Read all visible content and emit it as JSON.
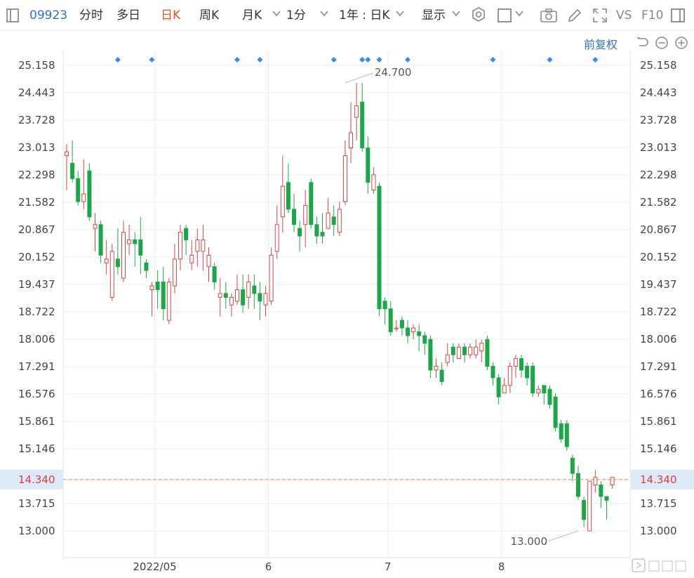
{
  "toolbar": {
    "code": "09923",
    "tabs": [
      "分时",
      "多日",
      "日K",
      "周K",
      "月K",
      "1分"
    ],
    "active_tab": "日K",
    "range": "1年 : 日K",
    "display": "显示",
    "vs": "VS",
    "f10": "F10"
  },
  "adjust_label": "前复权",
  "colors": {
    "up": "#d64545",
    "down": "#1aa846",
    "grid": "#eeeeee",
    "current": "#f07c3e",
    "accent": "#2f75c8",
    "marker": "#2f8ef0"
  },
  "chart_data": {
    "type": "candlestick",
    "ylim": [
      12.75,
      25.4
    ],
    "y_ticks": [
      "25.158",
      "24.443",
      "23.728",
      "23.013",
      "22.298",
      "21.582",
      "20.867",
      "20.152",
      "19.437",
      "18.722",
      "18.006",
      "17.291",
      "16.576",
      "15.861",
      "15.146",
      "13.715",
      "13.000"
    ],
    "current_price": "14.340",
    "x_labels": [
      "2022/05",
      "6",
      "7",
      "8"
    ],
    "x_label_index": [
      15.5,
      35.5,
      56.5,
      76.5
    ],
    "max_label": "24.700",
    "min_label": "13.000",
    "max_index": 49,
    "min_index": 90,
    "event_markers": [
      9,
      15,
      30,
      34,
      47,
      52,
      53,
      55,
      60,
      75,
      85,
      93
    ],
    "candles": [
      [
        22.8,
        22.9,
        21.9,
        23.1
      ],
      [
        22.6,
        22.2,
        22.1,
        23.2
      ],
      [
        22.2,
        21.6,
        21.5,
        22.4
      ],
      [
        21.6,
        21.8,
        21.4,
        22.7
      ],
      [
        22.4,
        21.2,
        21.1,
        22.6
      ],
      [
        20.9,
        21.0,
        20.3,
        21.3
      ],
      [
        21.0,
        20.2,
        20.0,
        21.1
      ],
      [
        20.0,
        20.1,
        19.7,
        20.6
      ],
      [
        19.1,
        20.3,
        19.0,
        20.5
      ],
      [
        20.1,
        19.9,
        19.7,
        20.9
      ],
      [
        19.6,
        20.8,
        19.5,
        21.1
      ],
      [
        20.5,
        20.6,
        20.2,
        21.0
      ],
      [
        20.6,
        20.5,
        19.9,
        20.8
      ],
      [
        20.6,
        20.2,
        19.7,
        21.2
      ],
      [
        20.0,
        19.8,
        19.6,
        20.1
      ],
      [
        19.3,
        19.4,
        18.6,
        19.5
      ],
      [
        19.5,
        19.3,
        18.8,
        19.8
      ],
      [
        19.5,
        18.8,
        18.5,
        19.9
      ],
      [
        18.5,
        19.5,
        18.4,
        19.6
      ],
      [
        19.4,
        20.1,
        19.2,
        20.5
      ],
      [
        20.1,
        20.8,
        19.8,
        21.0
      ],
      [
        20.9,
        20.6,
        20.2,
        21.0
      ],
      [
        20.0,
        20.2,
        19.8,
        20.6
      ],
      [
        20.3,
        20.6,
        19.9,
        20.9
      ],
      [
        20.3,
        20.6,
        19.8,
        21.0
      ],
      [
        19.9,
        20.2,
        19.5,
        20.4
      ],
      [
        19.9,
        19.5,
        19.3,
        20.0
      ],
      [
        19.1,
        19.2,
        18.6,
        19.6
      ],
      [
        19.2,
        19.1,
        18.8,
        19.5
      ],
      [
        18.9,
        19.1,
        18.6,
        19.2
      ],
      [
        19.0,
        19.3,
        18.9,
        19.7
      ],
      [
        19.3,
        18.9,
        18.7,
        19.7
      ],
      [
        19.1,
        19.5,
        18.8,
        19.7
      ],
      [
        19.4,
        19.2,
        18.8,
        19.7
      ],
      [
        19.2,
        19.0,
        18.5,
        19.5
      ],
      [
        18.9,
        19.2,
        18.6,
        19.4
      ],
      [
        19.0,
        20.2,
        18.9,
        20.4
      ],
      [
        20.3,
        21.0,
        20.1,
        21.5
      ],
      [
        21.2,
        22.0,
        20.8,
        22.8
      ],
      [
        22.1,
        21.4,
        21.3,
        22.6
      ],
      [
        21.4,
        21.0,
        20.8,
        21.8
      ],
      [
        20.9,
        20.7,
        20.3,
        21.1
      ],
      [
        21.0,
        21.5,
        20.4,
        21.9
      ],
      [
        22.1,
        21.0,
        20.9,
        22.2
      ],
      [
        21.0,
        20.7,
        20.5,
        21.2
      ],
      [
        20.8,
        20.7,
        20.5,
        21.3
      ],
      [
        20.9,
        21.3,
        20.9,
        21.7
      ],
      [
        21.2,
        21.0,
        20.7,
        21.5
      ],
      [
        20.8,
        21.4,
        20.7,
        21.6
      ],
      [
        21.6,
        22.8,
        21.5,
        23.2
      ],
      [
        23.0,
        23.4,
        22.6,
        24.2
      ],
      [
        23.8,
        24.1,
        23.2,
        24.7
      ],
      [
        24.2,
        23.0,
        22.9,
        24.7
      ],
      [
        23.0,
        22.1,
        21.8,
        23.3
      ],
      [
        21.9,
        22.3,
        21.8,
        22.5
      ],
      [
        22.0,
        18.8,
        18.6,
        22.1
      ],
      [
        19.0,
        18.8,
        18.4,
        19.1
      ],
      [
        18.8,
        18.2,
        18.1,
        19.0
      ],
      [
        18.3,
        18.3,
        18.2,
        18.5
      ],
      [
        18.5,
        18.3,
        18.1,
        18.6
      ],
      [
        18.3,
        18.1,
        17.9,
        18.5
      ],
      [
        18.2,
        18.3,
        18.0,
        18.4
      ],
      [
        18.2,
        18.1,
        17.7,
        18.4
      ],
      [
        18.1,
        17.9,
        17.6,
        18.2
      ],
      [
        18.0,
        17.2,
        17.0,
        18.1
      ],
      [
        17.2,
        17.3,
        17.0,
        17.5
      ],
      [
        17.2,
        16.9,
        16.8,
        17.4
      ],
      [
        17.4,
        17.6,
        17.3,
        17.9
      ],
      [
        17.8,
        17.6,
        17.4,
        17.9
      ],
      [
        17.5,
        17.8,
        17.5,
        17.9
      ],
      [
        17.8,
        17.6,
        17.4,
        17.9
      ],
      [
        17.6,
        17.8,
        17.5,
        17.9
      ],
      [
        17.6,
        17.8,
        17.5,
        18.0
      ],
      [
        17.7,
        17.9,
        17.4,
        18.0
      ],
      [
        18.0,
        17.3,
        17.2,
        18.1
      ],
      [
        17.3,
        17.0,
        16.8,
        17.4
      ],
      [
        17.0,
        16.5,
        16.3,
        17.1
      ],
      [
        16.6,
        16.8,
        16.6,
        17.0
      ],
      [
        16.8,
        17.3,
        16.6,
        17.4
      ],
      [
        17.3,
        17.5,
        17.0,
        17.6
      ],
      [
        17.5,
        17.2,
        17.0,
        17.6
      ],
      [
        17.3,
        17.0,
        16.8,
        17.4
      ],
      [
        17.3,
        16.6,
        16.5,
        17.4
      ],
      [
        16.6,
        16.7,
        16.5,
        16.8
      ],
      [
        16.8,
        16.6,
        16.3,
        16.8
      ],
      [
        16.7,
        16.3,
        16.2,
        16.8
      ],
      [
        16.5,
        15.7,
        15.6,
        16.6
      ],
      [
        15.8,
        15.4,
        15.3,
        15.9
      ],
      [
        15.8,
        15.2,
        15.1,
        15.9
      ],
      [
        14.9,
        14.5,
        14.3,
        15.0
      ],
      [
        14.5,
        13.9,
        13.8,
        14.7
      ],
      [
        13.8,
        13.3,
        13.1,
        13.9
      ],
      [
        13.0,
        14.3,
        13.0,
        14.3
      ],
      [
        14.2,
        14.4,
        14.0,
        14.6
      ],
      [
        14.2,
        13.9,
        13.6,
        14.3
      ],
      [
        13.9,
        13.8,
        13.3,
        13.9
      ],
      [
        14.2,
        14.4,
        14.1,
        14.4
      ]
    ]
  }
}
